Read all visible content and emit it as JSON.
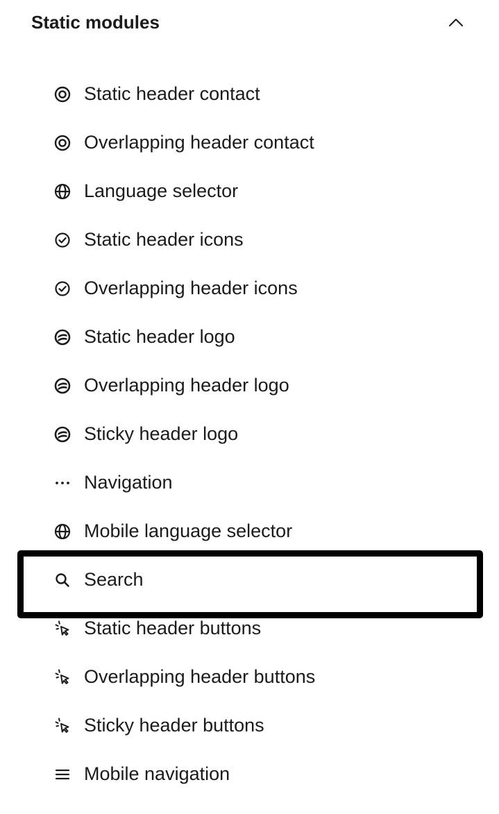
{
  "section": {
    "title": "Static modules",
    "toggle_icon": "chevron-up-icon",
    "expanded": true
  },
  "modules": [
    {
      "label": "Static header contact",
      "icon": "target-icon"
    },
    {
      "label": "Overlapping header contact",
      "icon": "target-icon"
    },
    {
      "label": "Language selector",
      "icon": "globe-icon"
    },
    {
      "label": "Static header icons",
      "icon": "check-circle-icon"
    },
    {
      "label": "Overlapping header icons",
      "icon": "check-circle-icon"
    },
    {
      "label": "Static header logo",
      "icon": "logo-icon"
    },
    {
      "label": "Overlapping header logo",
      "icon": "logo-icon"
    },
    {
      "label": "Sticky header logo",
      "icon": "logo-icon"
    },
    {
      "label": "Navigation",
      "icon": "more-dots-icon"
    },
    {
      "label": "Mobile language selector",
      "icon": "globe-icon"
    },
    {
      "label": "Search",
      "icon": "search-icon",
      "selected": true
    },
    {
      "label": "Static header buttons",
      "icon": "cursor-click-icon"
    },
    {
      "label": "Overlapping header buttons",
      "icon": "cursor-click-icon"
    },
    {
      "label": "Sticky header buttons",
      "icon": "cursor-click-icon"
    },
    {
      "label": "Mobile navigation",
      "icon": "menu-lines-icon"
    }
  ],
  "colors": {
    "text": "#1b1b1b",
    "selection_border": "#000000",
    "background": "#ffffff"
  }
}
